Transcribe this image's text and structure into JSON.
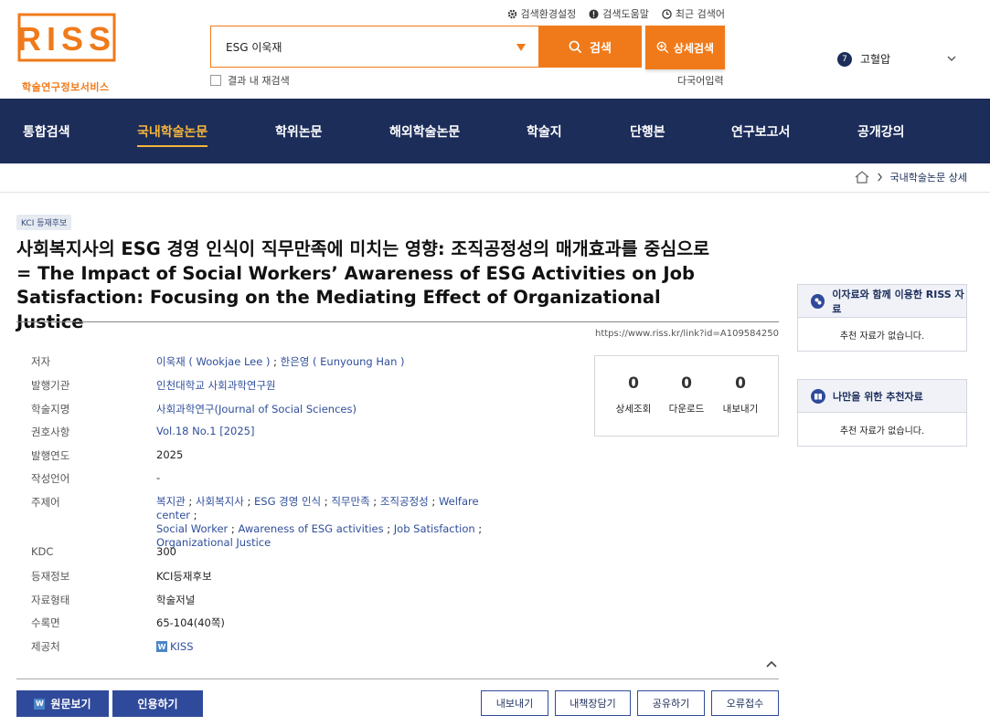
{
  "logo": {
    "text": "RISS",
    "subtitle": "학술연구정보서비스"
  },
  "utility": {
    "settings_label": "검색환경설정",
    "help_label": "검색도움말",
    "recent_label": "최근 검색어"
  },
  "search": {
    "query": "ESG 이욱재",
    "button_label": "검색",
    "advanced_label": "상세검색",
    "in_results_label": "결과 내 재검색",
    "multilang_label": "다국어입력"
  },
  "user": {
    "badge": "7",
    "name": "고혈압"
  },
  "nav": {
    "items": [
      "통합검색",
      "국내학술논문",
      "학위논문",
      "해외학술논문",
      "학술지",
      "단행본",
      "연구보고서",
      "공개강의"
    ],
    "active": "국내학술논문"
  },
  "breadcrumb": {
    "current": "국내학술논문 상세"
  },
  "article": {
    "tag": "KCI 등재후보",
    "title": "사회복지사의 ESG 경영 인식이 직무만족에 미치는 영향: 조직공정성의 매개효과를 중심으로 = The Impact of Social Workers’ Awareness of ESG Activities on Job Satisfaction: Focusing on the Mediating Effect of Organizational Justice",
    "permalink": "https://www.riss.kr/link?id=A109584250",
    "fields": {
      "author_key": "저자",
      "author1": "이욱재 ( Wookjae Lee )",
      "author2": "한은영 ( Eunyoung Han )",
      "publisher_key": "발행기관",
      "publisher": "인천대학교 사회과학연구원",
      "journal_key": "학술지명",
      "journal": "사회과학연구(Journal of Social Sciences)",
      "volume_key": "권호사항",
      "volume": "Vol.18 No.1 [2025]",
      "year_key": "발행연도",
      "year": "2025",
      "lang_key": "작성언어",
      "lang": "-",
      "keywords_key": "주제어",
      "keywords": [
        "복지관",
        "사회복지사",
        "ESG 경영 인식",
        "직무만족",
        "조직공정성",
        "Welfare center",
        "Social Worker",
        "Awareness of ESG activities",
        "Job Satisfaction",
        "Organizational Justice"
      ],
      "kdc_key": "KDC",
      "kdc": "300",
      "reg_key": "등재정보",
      "reg": "KCI등재후보",
      "type_key": "자료형태",
      "type": "학술저널",
      "pages_key": "수록면",
      "pages": "65-104(40쪽)",
      "provider_key": "제공처",
      "provider": "KISS",
      "provider_icon": "W"
    },
    "stats": [
      {
        "value": "0",
        "label": "상세조회"
      },
      {
        "value": "0",
        "label": "다운로드"
      },
      {
        "value": "0",
        "label": "내보내기"
      }
    ]
  },
  "actions": {
    "view_label": "원문보기",
    "cite_label": "인용하기",
    "export_label": "내보내기",
    "shelf_label": "내책장담기",
    "share_label": "공유하기",
    "report_label": "오류접수"
  },
  "side": {
    "panel1_title": "이자료와 함께 이용한 RISS 자료",
    "panel1_body": "추천 자료가 없습니다.",
    "panel2_title": "나만을 위한 추천자료",
    "panel2_body": "추천 자료가 없습니다."
  },
  "colors": {
    "brand_orange": "#f07a1a",
    "nav_navy": "#1c2d5a",
    "link_blue": "#2f4e9a",
    "nav_active": "#f5b53a"
  }
}
